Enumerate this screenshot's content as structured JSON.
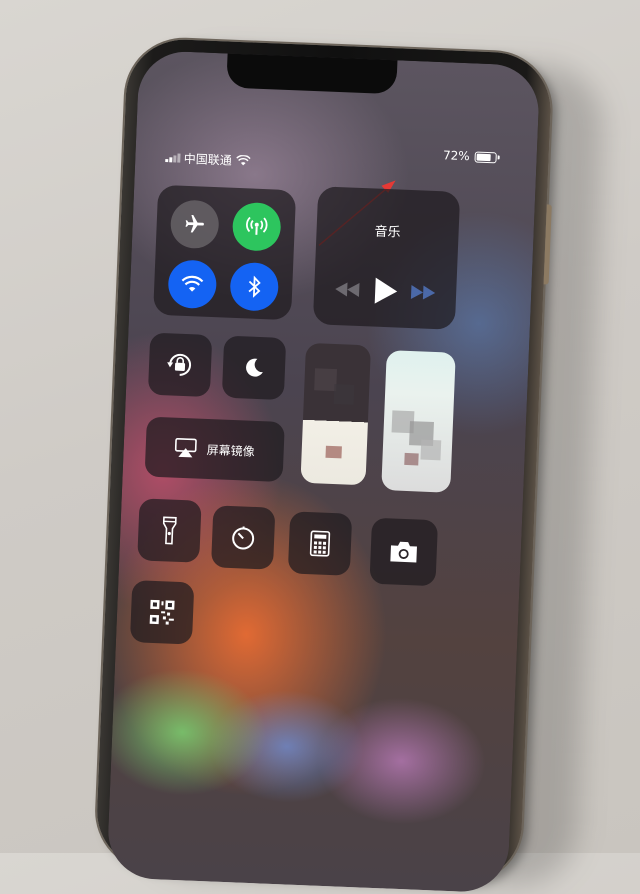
{
  "status": {
    "carrier": "中国联通",
    "battery": "72%",
    "battery_level": 0.72
  },
  "music": {
    "title": "音乐"
  },
  "controls": {
    "screen_mirroring_label": "屏幕镜像"
  },
  "colors": {
    "wifi_active": "#1463f3",
    "cellular_active": "#2dc55e",
    "annotation": "#e53935"
  }
}
